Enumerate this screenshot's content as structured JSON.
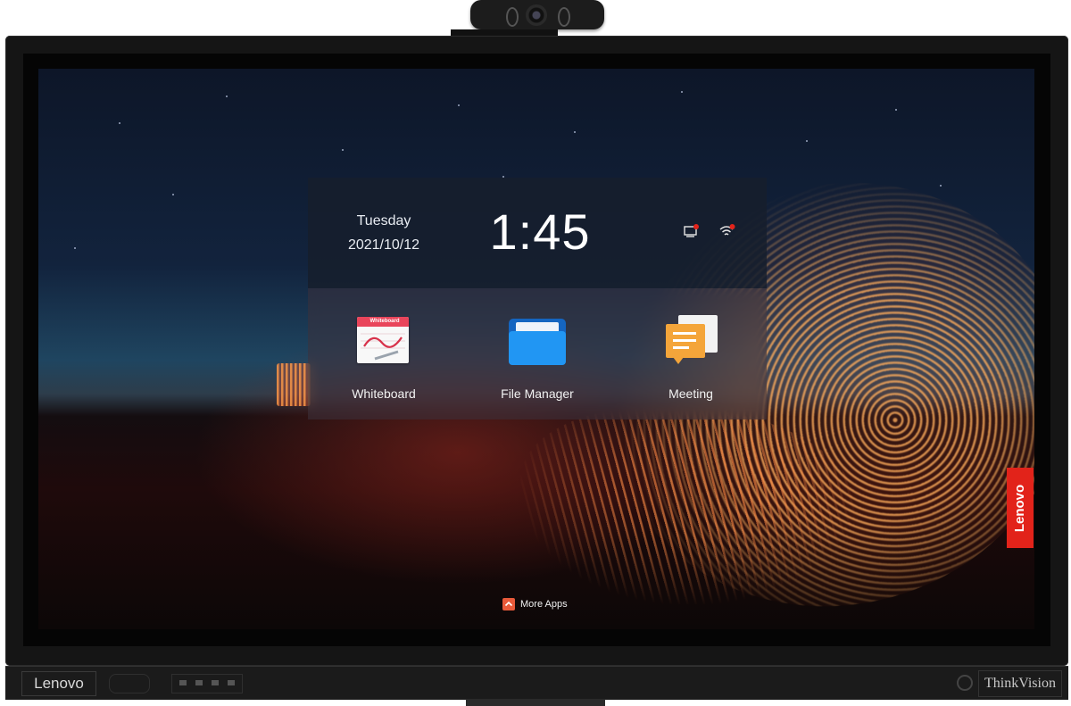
{
  "device": {
    "brand_left": "Lenovo",
    "brand_right": "ThinkVision",
    "side_tag": "Lenovo"
  },
  "header": {
    "day": "Tuesday",
    "date": "2021/10/12",
    "time": "1:45"
  },
  "status_icons": [
    "screen-cast-icon",
    "wifi-icon"
  ],
  "apps": [
    {
      "label": "Whiteboard",
      "icon": "whiteboard-icon",
      "icon_text": "Whiteboard"
    },
    {
      "label": "File Manager",
      "icon": "folder-icon"
    },
    {
      "label": "Meeting",
      "icon": "meeting-icon"
    }
  ],
  "more_apps": {
    "label": "More Apps",
    "icon": "chevron-up-icon"
  },
  "colors": {
    "accent_red": "#e2231a",
    "more_apps_accent": "#e85a3a",
    "folder_blue": "#2196f3",
    "meeting_orange": "#f4a53a",
    "whiteboard_red": "#e9455b"
  }
}
